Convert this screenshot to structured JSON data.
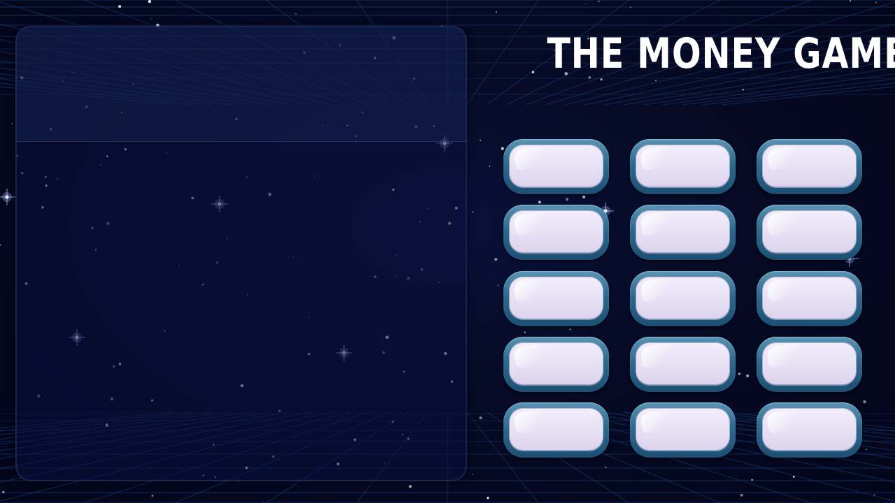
{
  "game": {
    "title": "THE MONEY GAME"
  },
  "question_panel": {
    "text": ""
  },
  "money_buttons": [
    {
      "label": ""
    },
    {
      "label": ""
    },
    {
      "label": ""
    },
    {
      "label": ""
    },
    {
      "label": ""
    },
    {
      "label": ""
    },
    {
      "label": ""
    },
    {
      "label": ""
    },
    {
      "label": ""
    },
    {
      "label": ""
    },
    {
      "label": ""
    },
    {
      "label": ""
    },
    {
      "label": ""
    },
    {
      "label": ""
    },
    {
      "label": ""
    }
  ],
  "colors": {
    "background": "#04061a",
    "grid_line": "#1c4a8a",
    "panel": "#0a103c",
    "button_frame": "#2d6a8e",
    "button_face": "#e6e0f4",
    "title": "#ffffff"
  }
}
